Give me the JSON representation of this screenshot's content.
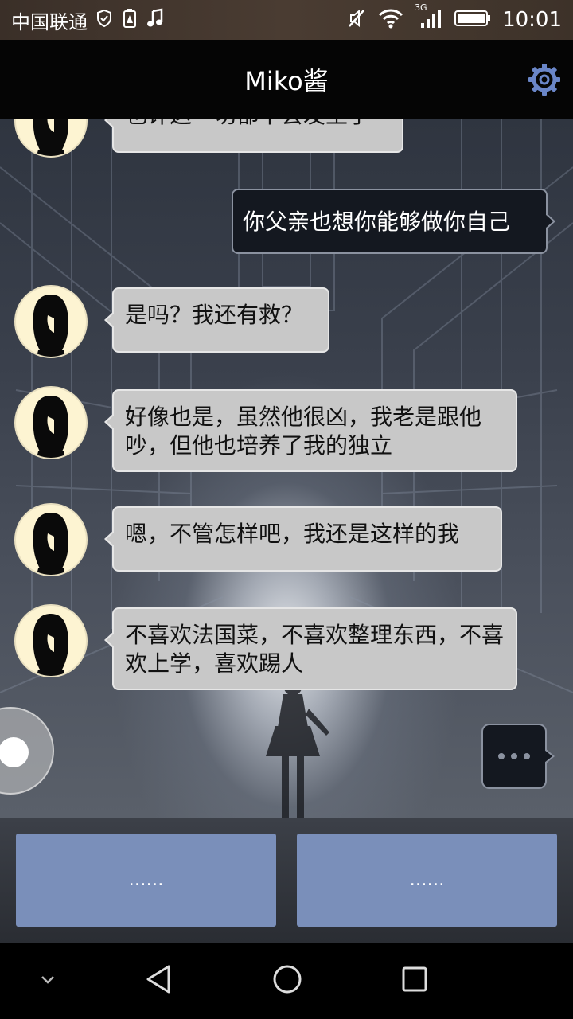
{
  "status_bar": {
    "carrier": "中国联通",
    "network": "3G",
    "time": "10:01"
  },
  "header": {
    "title": "Miko酱"
  },
  "messages": [
    {
      "side": "in",
      "text": "也许这一切都不会发生了"
    },
    {
      "side": "out",
      "text": "你父亲也想你能够做你自己"
    },
    {
      "side": "in",
      "text": "是吗？我还有救？"
    },
    {
      "side": "in",
      "text": "好像也是，虽然他很凶，我老是跟他吵，但他也培养了我的独立"
    },
    {
      "side": "in",
      "text": "嗯，不管怎样吧，我还是这样的我"
    },
    {
      "side": "in",
      "text": "不喜欢法国菜，不喜欢整理东西，不喜欢上学，喜欢踢人"
    }
  ],
  "reply_options": [
    {
      "label": "……"
    },
    {
      "label": "……"
    }
  ],
  "icons": {
    "settings": "gear-icon",
    "back": "back-triangle-icon",
    "home": "home-circle-icon",
    "recents": "recents-square-icon",
    "collapse": "chevron-down-icon"
  },
  "colors": {
    "reply_button": "#7a8fba",
    "incoming_bubble": "#c8c8c8",
    "outgoing_bubble": "#141820",
    "gear": "#6a86c8"
  }
}
